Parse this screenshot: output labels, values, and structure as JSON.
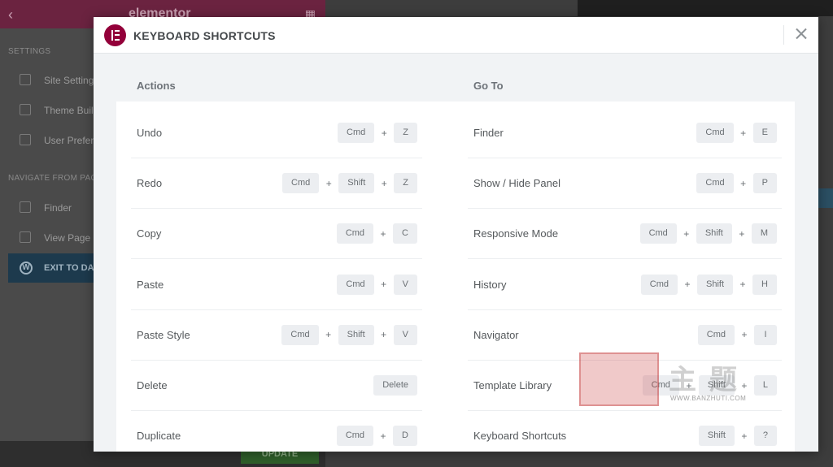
{
  "background": {
    "brand": "elementor",
    "sections": [
      "SETTINGS",
      "NAVIGATE FROM PAGE"
    ],
    "items": [
      "Site Settings",
      "Theme Builder",
      "User Preferences",
      "Finder",
      "View Page"
    ],
    "exit_label": "EXIT TO DASHBOARD",
    "update_label": "UPDATE"
  },
  "modal": {
    "title": "KEYBOARD SHORTCUTS",
    "close_icon": "close-icon",
    "brand_color": "#93003a",
    "left_column": {
      "title": "Actions",
      "rows": [
        {
          "label": "Undo",
          "keys": [
            "Cmd",
            "Z"
          ]
        },
        {
          "label": "Redo",
          "keys": [
            "Cmd",
            "Shift",
            "Z"
          ]
        },
        {
          "label": "Copy",
          "keys": [
            "Cmd",
            "C"
          ]
        },
        {
          "label": "Paste",
          "keys": [
            "Cmd",
            "V"
          ]
        },
        {
          "label": "Paste Style",
          "keys": [
            "Cmd",
            "Shift",
            "V"
          ]
        },
        {
          "label": "Delete",
          "keys": [
            "Delete"
          ]
        },
        {
          "label": "Duplicate",
          "keys": [
            "Cmd",
            "D"
          ]
        }
      ]
    },
    "right_column": {
      "title": "Go To",
      "rows": [
        {
          "label": "Finder",
          "keys": [
            "Cmd",
            "E"
          ]
        },
        {
          "label": "Show / Hide Panel",
          "keys": [
            "Cmd",
            "P"
          ]
        },
        {
          "label": "Responsive Mode",
          "keys": [
            "Cmd",
            "Shift",
            "M"
          ]
        },
        {
          "label": "History",
          "keys": [
            "Cmd",
            "Shift",
            "H"
          ]
        },
        {
          "label": "Navigator",
          "keys": [
            "Cmd",
            "I"
          ]
        },
        {
          "label": "Template Library",
          "keys": [
            "Cmd",
            "Shift",
            "L"
          ]
        },
        {
          "label": "Keyboard Shortcuts",
          "keys": [
            "Shift",
            "?"
          ]
        }
      ]
    }
  },
  "watermark": {
    "text": "主题",
    "url": "WWW.BANZHUTI.COM"
  }
}
